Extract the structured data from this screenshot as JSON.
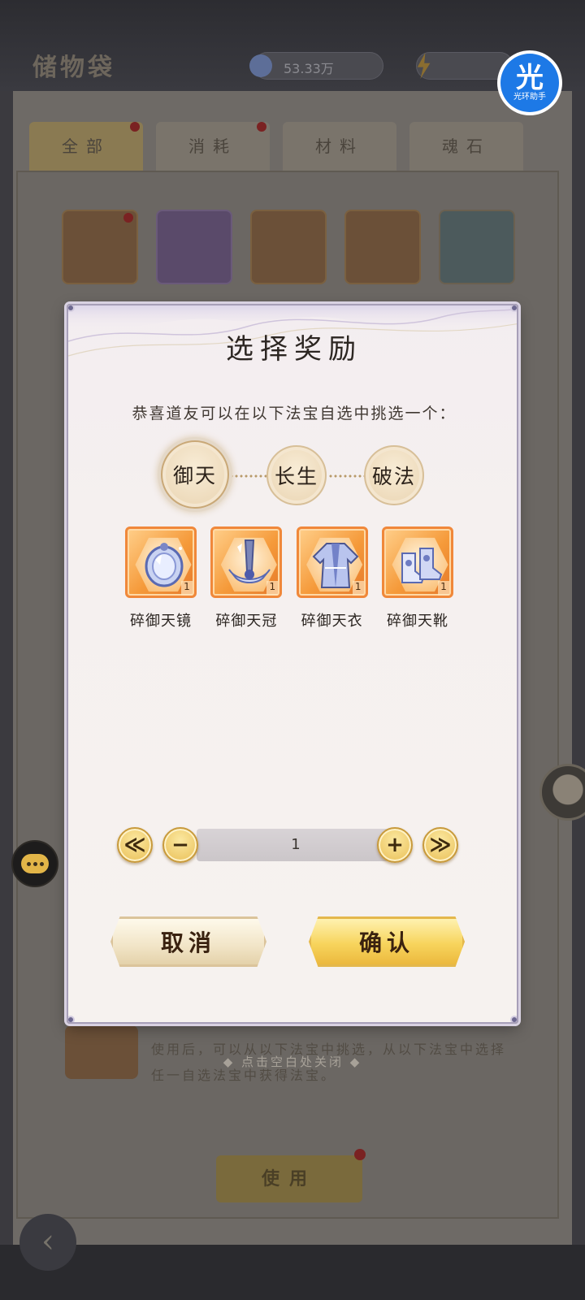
{
  "background": {
    "title": "储物袋",
    "currency_amount": "53.33万",
    "tabs": [
      "全部",
      "消耗",
      "材料",
      "魂石"
    ],
    "item_description": "使用后，可以从以下法宝中挑选，从以下法宝中选择任一自选法宝中获得法宝。",
    "use_button_label": "使用"
  },
  "watermark": {
    "glyph": "光",
    "text": "光环助手"
  },
  "dialog": {
    "title": "选择奖励",
    "subtitle": "恭喜道友可以在以下法宝自选中挑选一个：",
    "sets": [
      {
        "label": "御天",
        "selected": true
      },
      {
        "label": "长生",
        "selected": false
      },
      {
        "label": "破法",
        "selected": false
      }
    ],
    "rewards": [
      {
        "name": "碎御天镜",
        "quantity": "1",
        "icon": "mirror-icon"
      },
      {
        "name": "碎御天冠",
        "quantity": "1",
        "icon": "crown-icon"
      },
      {
        "name": "碎御天衣",
        "quantity": "1",
        "icon": "robe-icon"
      },
      {
        "name": "碎御天靴",
        "quantity": "1",
        "icon": "boots-icon"
      }
    ],
    "quantity": {
      "min_label": "≪",
      "decrement_label": "−",
      "value": "1",
      "increment_label": "+",
      "max_label": "≫"
    },
    "cancel_label": "取消",
    "confirm_label": "确认"
  },
  "close_hint": "◆ 点击空白处关闭 ◆",
  "colors": {
    "dialog_border": "#a79fb8",
    "reward_frame": "#f59a3a",
    "button_gold": "#f7d45c",
    "watermark_blue": "#1d79e6"
  }
}
